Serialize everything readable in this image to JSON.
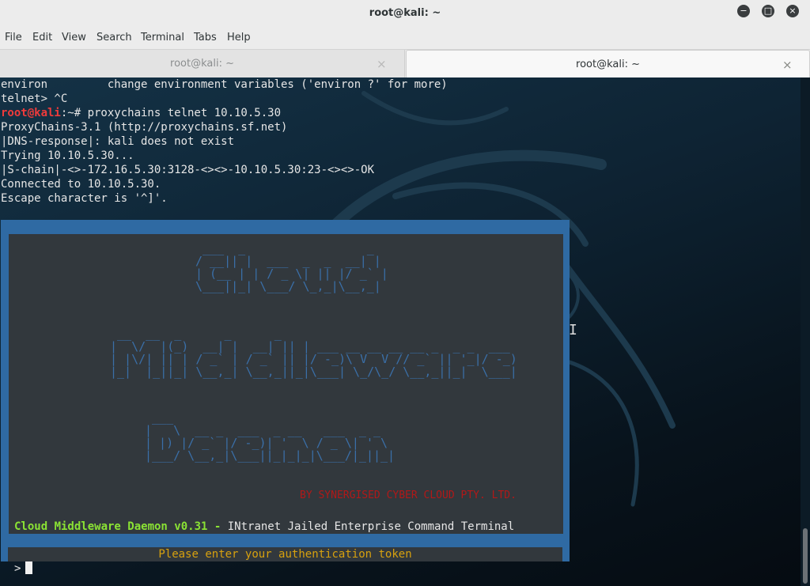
{
  "window": {
    "title": "root@kali: ~",
    "minimize_icon": "−",
    "maximize_icon": "□",
    "close_icon": "×"
  },
  "menu": [
    "File",
    "Edit",
    "View",
    "Search",
    "Terminal",
    "Tabs",
    "Help"
  ],
  "tabs": [
    {
      "label": "root@kali: ~",
      "active": false,
      "close": "×"
    },
    {
      "label": "root@kali: ~",
      "active": true,
      "close": "×"
    }
  ],
  "terminal": {
    "lines": [
      "environ         change environment variables ('environ ?' for more)",
      "telnet> ^C"
    ],
    "prompt_user": "root@kali",
    "prompt_rest": ":~# proxychains telnet 10.10.5.30",
    "output": [
      "ProxyChains-3.1 (http://proxychains.sf.net)",
      "|DNS-response|: kali does not exist",
      "Trying 10.10.5.30...",
      "|S-chain|-<>-172.16.5.30:3128-<><>-10.10.5.30:23-<><>-OK",
      "Connected to 10.10.5.30.",
      "Escape character is '^]'."
    ],
    "banner_art": [
      " ___  _                 _\n/ __|| |  ___  _  _  __| |\n| (__ | | / _ \\| || |/ _` |\n\\___||_| \\___/ \\_,_|\\__,_|",
      " __  __  _      _      _\n|  \\/  |(_)  __| |  __| || | ___ __ __ __ __ _  _ _  ___\n| |\\/| || | / _` | / _` || |/ -_)\\ V  V // _` || '_|/ -_)\n|_|  |_||_| \\__,_| \\__,_||_|\\___| \\_/\\_/ \\__,_||_|  \\___|",
      " ___\n|   \\  __ _  ___  _ __   ___  _ _\n| |) |/ _` |/ -_)| '  \\ / _ \\| ' \\\n|___/ \\__,_|\\___||_|_|_|\\___/|_||_|"
    ],
    "banner_by": "BY SYNERGISED CYBER CLOUD PTY. LTD.",
    "status_bold": "Cloud Middleware Daemon v0.31 -",
    "status_rest": " INtranet Jailed Enterprise Command Terminal",
    "auth_prompt": "Please enter your authentication token",
    "input_prompt": ">"
  },
  "colors": {
    "panel_frame": "#2f6aa3",
    "panel_bg": "#32383d",
    "banner_art": "#3a6fa8",
    "banner_by": "#b21818",
    "status_green": "#8ae234",
    "auth_prompt": "#d7a10f",
    "prompt_user": "#ef3b3b"
  }
}
